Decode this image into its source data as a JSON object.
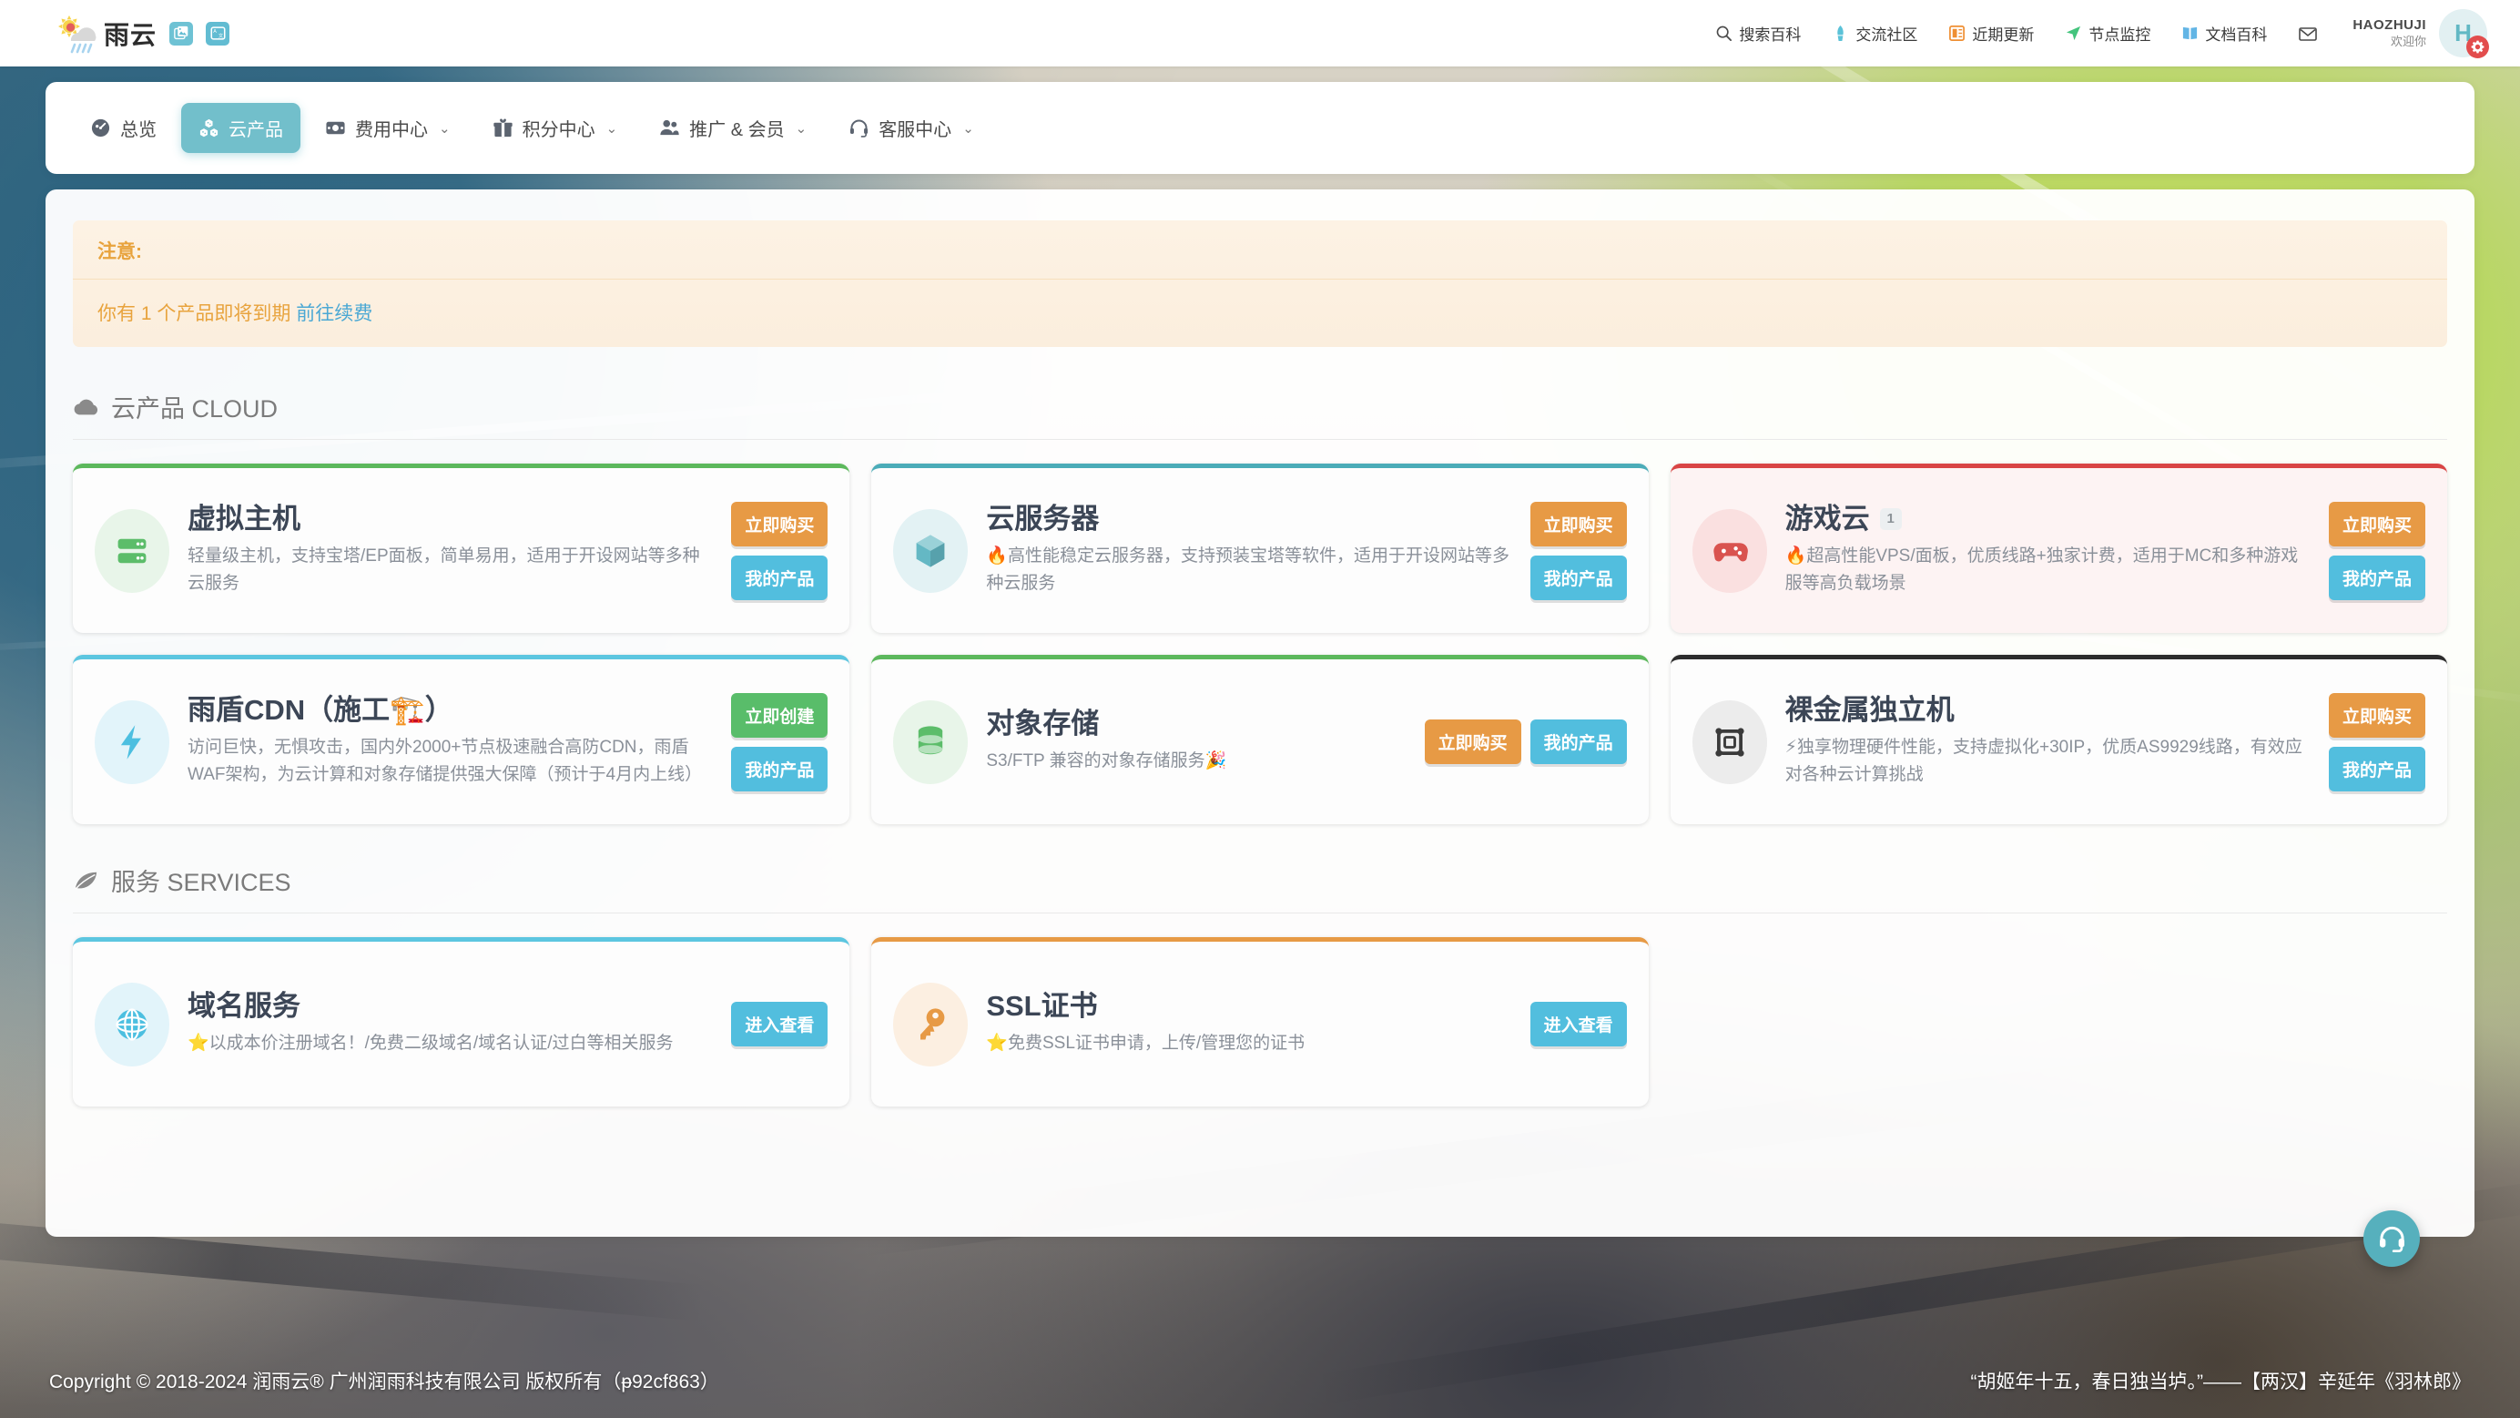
{
  "header": {
    "brand_name": "雨云",
    "icons": [
      {
        "name": "gallery-icon",
        "label": "图片"
      },
      {
        "name": "translate-icon",
        "label": "翻译"
      }
    ],
    "nav": [
      {
        "icon": "search-icon",
        "label": "搜索百科"
      },
      {
        "icon": "community-icon",
        "label": "交流社区"
      },
      {
        "icon": "update-icon",
        "label": "近期更新"
      },
      {
        "icon": "monitor-icon",
        "label": "节点监控"
      },
      {
        "icon": "docs-icon",
        "label": "文档百科"
      },
      {
        "icon": "mail-icon",
        "label": ""
      }
    ],
    "user": {
      "name": "HAOZHUJI",
      "welcome": "欢迎你",
      "avatar_letter": "H"
    }
  },
  "mainnav": [
    {
      "icon": "dashboard-icon",
      "label": "总览",
      "active": false,
      "caret": false
    },
    {
      "icon": "cloud-cubes-icon",
      "label": "云产品",
      "active": true,
      "caret": false
    },
    {
      "icon": "money-icon",
      "label": "费用中心",
      "active": false,
      "caret": true
    },
    {
      "icon": "gift-icon",
      "label": "积分中心",
      "active": false,
      "caret": true
    },
    {
      "icon": "users-icon",
      "label": "推广 & 会员",
      "active": false,
      "caret": true
    },
    {
      "icon": "headset-icon",
      "label": "客服中心",
      "active": false,
      "caret": true
    }
  ],
  "notice": {
    "title": "注意:",
    "message": "你有 1 个产品即将到期",
    "link": "前往续费"
  },
  "sections": [
    {
      "icon": "cloud-icon",
      "heading": "云产品 CLOUD",
      "cards": [
        {
          "name": "virtual-host",
          "title": "虚拟主机",
          "badge": "",
          "desc": "轻量级主机，支持宝塔/EP面板，简单易用，适用于开设网站等多种云服务",
          "accent": "#5cb85c",
          "icon": "server-icon",
          "icon_bg": "#e8f5e9",
          "icon_color": "#5cbd6a",
          "tinted": false,
          "actions_layout": "column",
          "buttons": [
            {
              "label": "立即购买",
              "style": "orange"
            },
            {
              "label": "我的产品",
              "style": "blue"
            }
          ]
        },
        {
          "name": "cloud-server",
          "title": "云服务器",
          "badge": "",
          "desc": "🔥高性能稳定云服务器，支持预装宝塔等软件，适用于开设网站等多种云服务",
          "accent": "#4bacb8",
          "icon": "cube-icon",
          "icon_bg": "#e3f2f4",
          "icon_color": "#64b8c4",
          "tinted": false,
          "actions_layout": "column",
          "buttons": [
            {
              "label": "立即购买",
              "style": "orange"
            },
            {
              "label": "我的产品",
              "style": "blue"
            }
          ]
        },
        {
          "name": "game-cloud",
          "title": "游戏云",
          "badge": "1",
          "desc": "🔥超高性能VPS/面板，优质线路+独家计费，适用于MC和多种游戏服等高负载场景",
          "accent": "#d94545",
          "icon": "gamepad-icon",
          "icon_bg": "#fae0e0",
          "icon_color": "#d9534f",
          "tinted": true,
          "actions_layout": "column",
          "buttons": [
            {
              "label": "立即购买",
              "style": "orange"
            },
            {
              "label": "我的产品",
              "style": "blue"
            }
          ]
        },
        {
          "name": "yudun-cdn",
          "title": "雨盾CDN（施工🏗️）",
          "badge": "",
          "desc": "访问巨快，无惧攻击，国内外2000+节点极速融合高防CDN，雨盾WAF架构，为云计算和对象存储提供强大保障（预计于4月内上线）",
          "accent": "#5cc6e0",
          "icon": "bolt-icon",
          "icon_bg": "#e2f4fa",
          "icon_color": "#4cbfe0",
          "tinted": false,
          "actions_layout": "column",
          "buttons": [
            {
              "label": "立即创建",
              "style": "green"
            },
            {
              "label": "我的产品",
              "style": "blue"
            }
          ]
        },
        {
          "name": "object-storage",
          "title": "对象存储",
          "badge": "",
          "desc": "S3/FTP 兼容的对象存储服务🎉",
          "accent": "#5cb85c",
          "icon": "database-icon",
          "icon_bg": "#e8f5e9",
          "icon_color": "#5cbd6a",
          "tinted": false,
          "actions_layout": "row",
          "buttons": [
            {
              "label": "立即购买",
              "style": "orange"
            },
            {
              "label": "我的产品",
              "style": "blue"
            }
          ]
        },
        {
          "name": "bare-metal",
          "title": "裸金属独立机",
          "badge": "",
          "desc": "⚡独享物理硬件性能，支持虚拟化+30IP，优质AS9929线路，有效应对各种云计算挑战",
          "accent": "#2c2c2c",
          "icon": "chip-icon",
          "icon_bg": "#ececec",
          "icon_color": "#3a3a3a",
          "tinted": false,
          "actions_layout": "column",
          "buttons": [
            {
              "label": "立即购买",
              "style": "orange"
            },
            {
              "label": "我的产品",
              "style": "blue"
            }
          ]
        }
      ]
    },
    {
      "icon": "leaf-icon",
      "heading": "服务 SERVICES",
      "cards": [
        {
          "name": "domain-service",
          "title": "域名服务",
          "badge": "",
          "desc": "⭐以成本价注册域名！/免费二级域名/域名认证/过白等相关服务",
          "accent": "#5cc6e0",
          "icon": "globe-icon",
          "icon_bg": "#e2f4fa",
          "icon_color": "#4cbfe0",
          "tinted": false,
          "actions_layout": "column",
          "buttons": [
            {
              "label": "进入查看",
              "style": "blue"
            }
          ]
        },
        {
          "name": "ssl-certificate",
          "title": "SSL证书",
          "badge": "",
          "desc": "⭐免费SSL证书申请，上传/管理您的证书",
          "accent": "#e79a45",
          "icon": "key-icon",
          "icon_bg": "#fcefe1",
          "icon_color": "#e79a45",
          "tinted": false,
          "actions_layout": "column",
          "buttons": [
            {
              "label": "进入查看",
              "style": "blue"
            }
          ]
        }
      ]
    }
  ],
  "support_fab": {
    "name": "headset-icon",
    "label": "客服"
  },
  "footer": {
    "copyright": "Copyright © 2018-2024 润雨云® 广州润雨科技有限公司 版权所有（ᵽ92cf863）",
    "quote": "“胡姬年十五，春日独当垆。”——【两汉】辛延年《羽林郎》"
  }
}
